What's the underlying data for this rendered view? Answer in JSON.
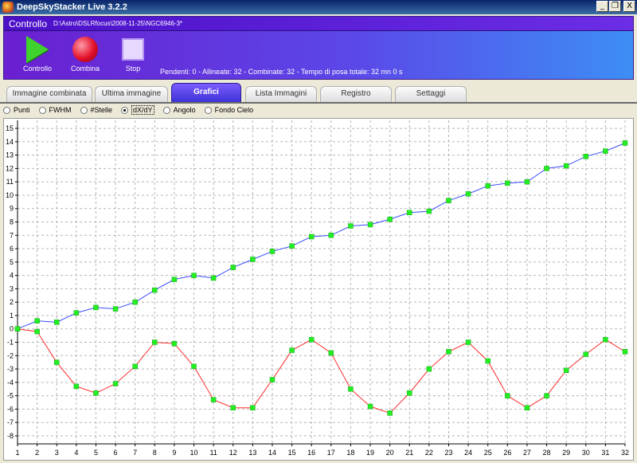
{
  "window": {
    "title": "DeepSkyStacker Live 3.2.2",
    "minimize": "_",
    "restore": "❐",
    "close": "X"
  },
  "control_panel": {
    "title": "Controllo",
    "path": "D:\\Astro\\DSLRfocus\\2008-11-25\\NGC6946-3*",
    "buttons": {
      "controllo": "Controllo",
      "combina": "Combina",
      "stop": "Stop"
    },
    "status": "Pendenti: 0 - Allineate: 32 - Combinate: 32 - Tempo di posa totale: 32 mn 0 s"
  },
  "tabs": [
    {
      "label": "Immagine combinata",
      "active": false
    },
    {
      "label": "Ultima immagine",
      "active": false
    },
    {
      "label": "Grafici",
      "active": true
    },
    {
      "label": "Lista Immagini",
      "active": false
    },
    {
      "label": "Registro",
      "active": false
    },
    {
      "label": "Settaggi",
      "active": false
    }
  ],
  "graph_options": [
    {
      "label": "Punti",
      "checked": false
    },
    {
      "label": "FWHM",
      "checked": false
    },
    {
      "label": "#Stelle",
      "checked": false
    },
    {
      "label": "dX/dY",
      "checked": true
    },
    {
      "label": "Angolo",
      "checked": false
    },
    {
      "label": "Fondo Cielo",
      "checked": false
    }
  ],
  "chart_data": {
    "type": "line",
    "x": [
      1,
      2,
      3,
      4,
      5,
      6,
      7,
      8,
      9,
      10,
      11,
      12,
      13,
      14,
      15,
      16,
      17,
      18,
      19,
      20,
      21,
      22,
      23,
      24,
      25,
      26,
      27,
      28,
      29,
      30,
      31,
      32
    ],
    "series": [
      {
        "values": [
          0.0,
          0.6,
          0.5,
          1.2,
          1.6,
          1.5,
          2.0,
          2.9,
          3.7,
          4.0,
          3.8,
          4.6,
          5.2,
          5.8,
          6.2,
          6.9,
          7.0,
          7.7,
          7.8,
          8.2,
          8.7,
          8.8,
          9.6,
          10.1,
          10.7,
          10.9,
          11.0,
          12.0,
          12.2,
          12.9,
          13.3,
          13.9
        ],
        "color": "#3a4dff"
      },
      {
        "values": [
          0.0,
          -0.2,
          -2.5,
          -4.3,
          -4.8,
          -4.1,
          -2.8,
          -1.0,
          -1.1,
          -2.8,
          -5.3,
          -5.9,
          -5.9,
          -3.8,
          -1.6,
          -0.8,
          -1.8,
          -4.5,
          -5.8,
          -6.3,
          -4.8,
          -3.0,
          -1.7,
          -1.0,
          -2.4,
          -5.0,
          -5.9,
          -5.0,
          -3.1,
          -1.9,
          -0.8,
          -1.7
        ],
        "color": "#ff2a2a"
      }
    ],
    "point_color": "#22ee22",
    "xlim": [
      1,
      32
    ],
    "ylim": [
      -8.6,
      15.6
    ],
    "yticks": [
      -8,
      -7,
      -6,
      -5,
      -4,
      -3,
      -2,
      -1,
      0,
      1,
      2,
      3,
      4,
      5,
      6,
      7,
      8,
      9,
      10,
      11,
      12,
      13,
      14,
      15
    ],
    "grid": true
  }
}
